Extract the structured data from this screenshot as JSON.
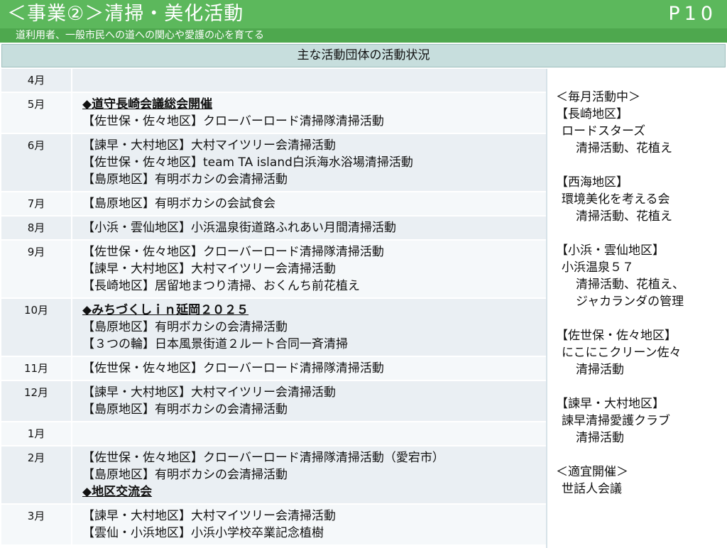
{
  "header": {
    "title": "＜事業②＞清掃・美化活動",
    "page_no": "P10",
    "subtitle": "道利用者、一般市民への道への関心や愛護の心を育てる"
  },
  "table": {
    "heading": "主な活動団体の活動状況",
    "rows": [
      {
        "month": "4月",
        "lines": []
      },
      {
        "month": "5月",
        "lines": [
          {
            "text": "◆道守長崎会議総会開催",
            "highlight": true
          },
          {
            "text": "【佐世保・佐々地区】クローバーロード清掃隊清掃活動"
          }
        ]
      },
      {
        "month": "6月",
        "lines": [
          {
            "text": "【諫早・大村地区】大村マイツリー会清掃活動"
          },
          {
            "text": "【佐世保・佐々地区】team TA island白浜海水浴場清掃活動"
          },
          {
            "text": "【島原地区】有明ボカシの会清掃活動"
          }
        ]
      },
      {
        "month": "7月",
        "lines": [
          {
            "text": "【島原地区】有明ボカシの会試食会"
          }
        ]
      },
      {
        "month": "8月",
        "lines": [
          {
            "text": "【小浜・雲仙地区】小浜温泉街道路ふれあい月間清掃活動"
          }
        ]
      },
      {
        "month": "9月",
        "lines": [
          {
            "text": "【佐世保・佐々地区】クローバーロード清掃隊清掃活動"
          },
          {
            "text": "【諫早・大村地区】大村マイツリー会清掃活動"
          },
          {
            "text": "【長崎地区】居留地まつり清掃、おくんち前花植え"
          }
        ]
      },
      {
        "month": "10月",
        "lines": [
          {
            "text": "◆みちづくしｉｎ延岡２０２５",
            "highlight": true
          },
          {
            "text": "【島原地区】有明ボカシの会清掃活動"
          },
          {
            "text": "【３つの輪】日本風景街道２ルート合同一斉清掃"
          }
        ]
      },
      {
        "month": "11月",
        "lines": [
          {
            "text": "【佐世保・佐々地区】クローバーロード清掃隊清掃活動"
          }
        ]
      },
      {
        "month": "12月",
        "lines": [
          {
            "text": "【諫早・大村地区】大村マイツリー会清掃活動"
          },
          {
            "text": "【島原地区】有明ボカシの会清掃活動"
          }
        ]
      },
      {
        "month": "1月",
        "lines": []
      },
      {
        "month": "2月",
        "lines": [
          {
            "text": "【佐世保・佐々地区】クローバーロード清掃隊清掃活動（愛宕市）"
          },
          {
            "text": "【島原地区】有明ボカシの会清掃活動"
          },
          {
            "text": "◆地区交流会",
            "highlight": true
          }
        ]
      },
      {
        "month": "3月",
        "lines": [
          {
            "text": "【諫早・大村地区】大村マイツリー会清掃活動"
          },
          {
            "text": "【雲仙・小浜地区】小浜小学校卒業記念植樹"
          }
        ]
      }
    ]
  },
  "side": {
    "heading": "＜毎月活動中＞",
    "groups": [
      {
        "area": "【長崎地区】",
        "group": "ロードスターズ",
        "activities": [
          "清掃活動、花植え"
        ]
      },
      {
        "area": "【西海地区】",
        "group": "環境美化を考える会",
        "activities": [
          "清掃活動、花植え"
        ]
      },
      {
        "area": "【小浜・雲仙地区】",
        "group": "小浜温泉５７",
        "activities": [
          "清掃活動、花植え、",
          "ジャカランダの管理"
        ]
      },
      {
        "area": "【佐世保・佐々地区】",
        "group": "にこにこクリーン佐々",
        "activities": [
          "清掃活動"
        ]
      },
      {
        "area": "【諫早・大村地区】",
        "group": "諫早清掃愛護クラブ",
        "activities": [
          "清掃活動"
        ]
      }
    ],
    "footer_heading": "＜適宜開催＞",
    "footer_item": "世話人会議"
  }
}
